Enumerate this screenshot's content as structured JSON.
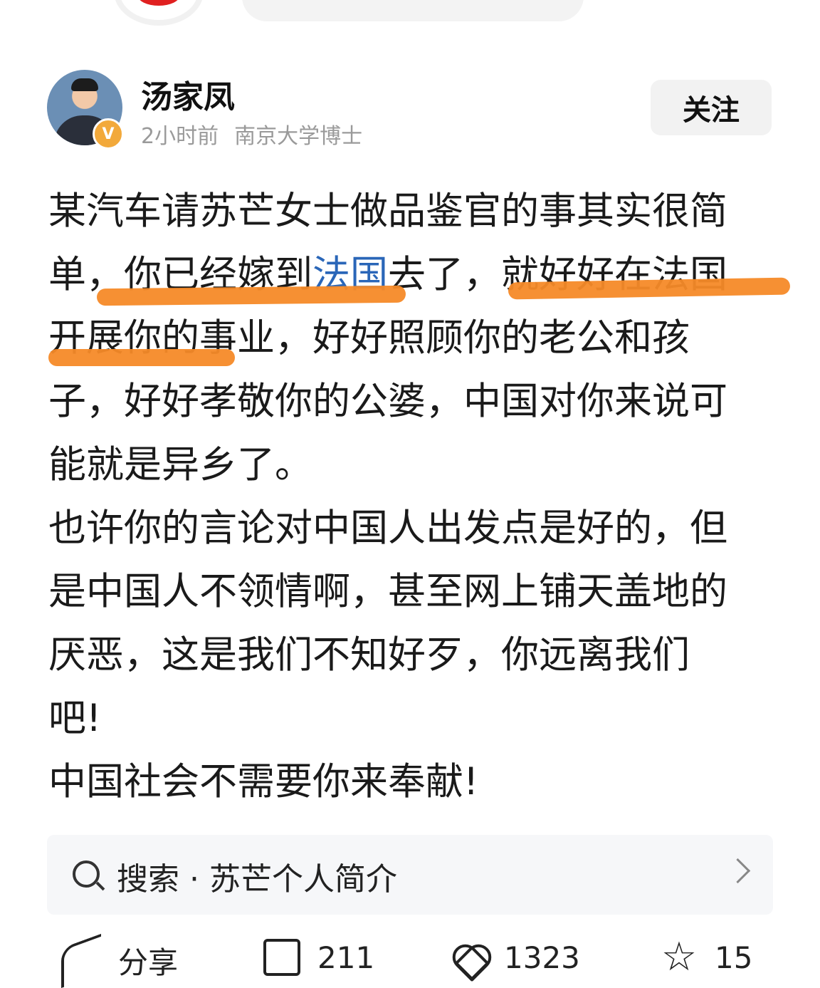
{
  "author": {
    "name": "汤家凤",
    "time": "2小时前",
    "title": "南京大学博士",
    "verified_badge": "V",
    "follow_label": "关注"
  },
  "post": {
    "lines": [
      [
        "某汽车请苏芒女士做品鉴官的事其实很简"
      ],
      [
        "单，你已经嫁到",
        "法国",
        "去了，就好好在法国"
      ],
      [
        "开展你的事业，好好照顾你的老公和孩"
      ],
      [
        "子，好好孝敬你的公婆，中国对你来说可"
      ],
      [
        "能就是异乡了。"
      ],
      [
        "也许你的言论对中国人出发点是好的，但"
      ],
      [
        "是中国人不领情啊，甚至网上铺天盖地的"
      ],
      [
        "厌恶，这是我们不知好歹，你远离我们"
      ],
      [
        "吧!"
      ],
      [
        "中国社会不需要你来奉献!"
      ]
    ],
    "link_color": "#2a66b8",
    "highlight_color": "#f58a28"
  },
  "search_suggestion": {
    "label": "搜索 · 苏芒个人简介",
    "icon": "search-icon"
  },
  "actions": {
    "share_label": "分享",
    "comment_count": "211",
    "like_count": "1323",
    "favorite_count": "15"
  }
}
